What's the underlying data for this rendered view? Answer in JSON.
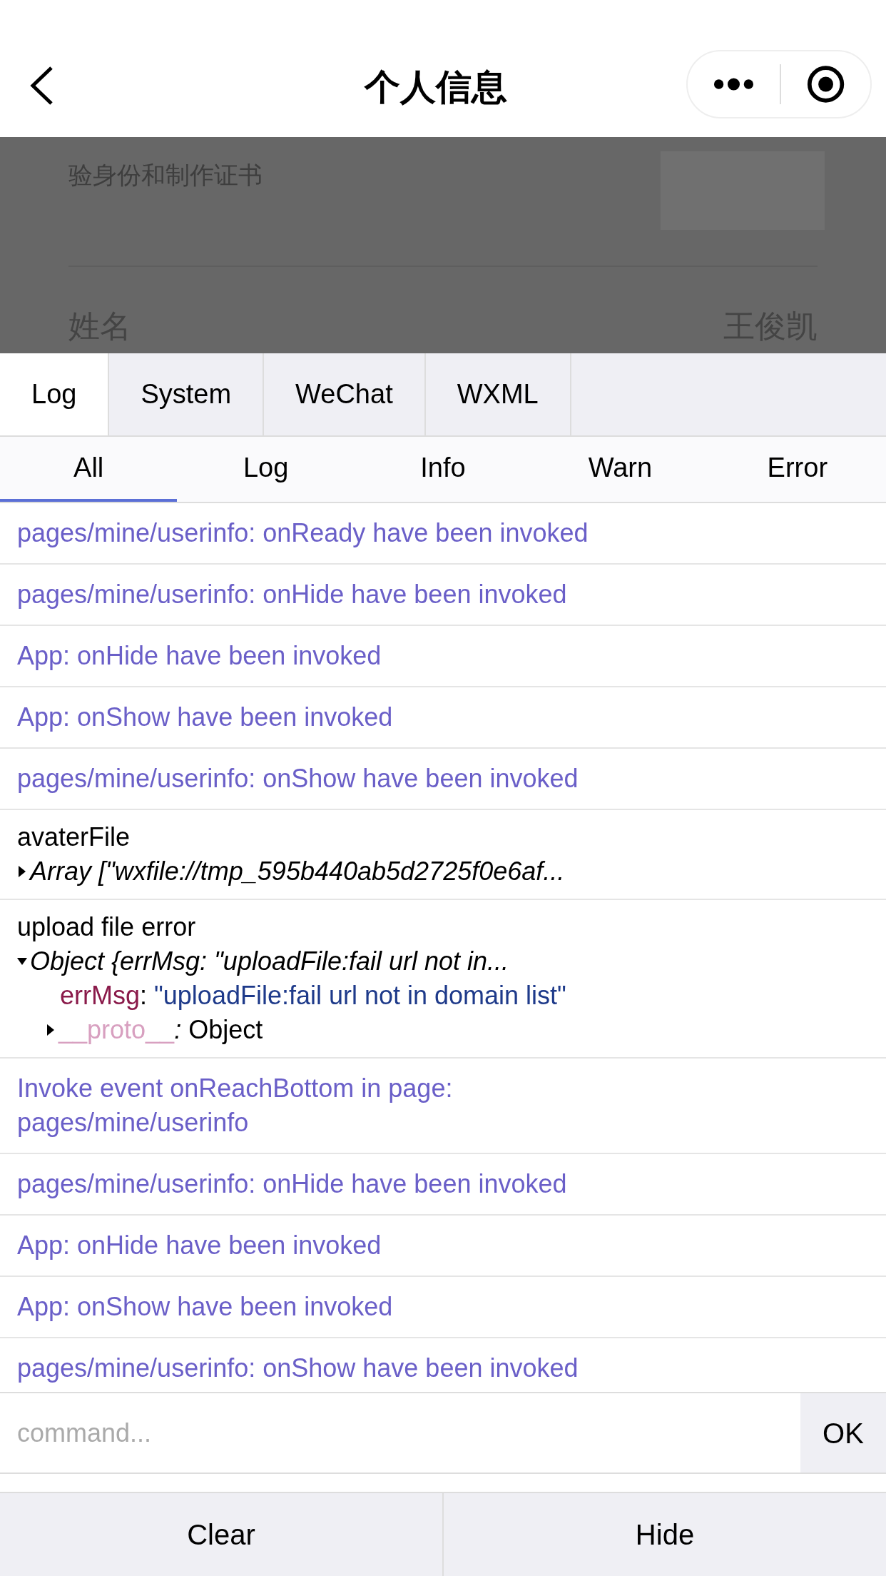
{
  "nav": {
    "title": "个人信息"
  },
  "background_page": {
    "note": "验身份和制作证书",
    "field_label": "姓名",
    "field_value": "王俊凯"
  },
  "tabs": [
    {
      "label": "Log",
      "selected": true
    },
    {
      "label": "System",
      "selected": false
    },
    {
      "label": "WeChat",
      "selected": false
    },
    {
      "label": "WXML",
      "selected": false
    }
  ],
  "filters": [
    {
      "label": "All",
      "selected": true
    },
    {
      "label": "Log",
      "selected": false
    },
    {
      "label": "Info",
      "selected": false
    },
    {
      "label": "Warn",
      "selected": false
    },
    {
      "label": "Error",
      "selected": false
    }
  ],
  "log_entries": [
    {
      "kind": "info",
      "text": "pages/mine/userinfo: onReady have been invoked"
    },
    {
      "kind": "info",
      "text": "pages/mine/userinfo: onHide have been invoked"
    },
    {
      "kind": "info",
      "text": "App: onHide have been invoked"
    },
    {
      "kind": "info",
      "text": "App: onShow have been invoked"
    },
    {
      "kind": "info",
      "text": "pages/mine/userinfo: onShow have been invoked"
    },
    {
      "kind": "object",
      "text": "avaterFile",
      "summary": "Array [\"wxfile://tmp_595b440ab5d2725f0e6af...",
      "expanded": false
    },
    {
      "kind": "object",
      "text": "upload file error",
      "summary": "Object {errMsg: \"uploadFile:fail url not in...",
      "expanded": true,
      "children": [
        {
          "kind": "string",
          "key": "errMsg",
          "sep": ":",
          "value": "\"uploadFile:fail url not in domain list\""
        },
        {
          "kind": "proto",
          "key": "__proto__",
          "sep": ":",
          "value": "Object",
          "expanded": false
        }
      ]
    },
    {
      "kind": "info",
      "text": "Invoke event onReachBottom in page: pages/mine/userinfo"
    },
    {
      "kind": "info",
      "text": "pages/mine/userinfo: onHide have been invoked"
    },
    {
      "kind": "info",
      "text": "App: onHide have been invoked"
    },
    {
      "kind": "info",
      "text": "App: onShow have been invoked"
    },
    {
      "kind": "info",
      "text": "pages/mine/userinfo: onShow have been invoked"
    }
  ],
  "command": {
    "placeholder": "command...",
    "button": "OK"
  },
  "footer_buttons": [
    "Clear",
    "Hide"
  ]
}
